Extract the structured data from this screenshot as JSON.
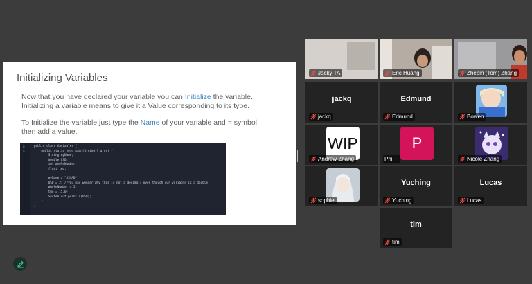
{
  "slide": {
    "title": "Initializing Variables",
    "para1_a": "Now that you have declared your variable you can ",
    "para1_hl": "Initialize",
    "para1_b": " the variable.",
    "para1_line2": "Initializing a variable means to give it a Value corresponding to its type.",
    "para2_a": "To Initialize the variable just type the ",
    "para2_hl1": "Name",
    "para2_b": " of your variable and ",
    "para2_hl2": "=",
    "para2_c": " symbol",
    "para2_line2": "then add a value."
  },
  "code_lines": [
    "public class Variables {",
    "    public static void main(String[] args) {",
    "        String myName;",
    "        double USD;",
    "        int wholeNumber;",
    "        float two;",
    "",
    "        myName = \"ASSAD\";",
    "        USD = 2; //you may wonder why this is not a decimal? even though our variable is a double",
    "        wholeNumber = 5;",
    "        two = 15.0F;",
    "        System.out.println(USD);",
    "    }",
    "}"
  ],
  "participants": [
    {
      "label": "Jacky TA",
      "big": "",
      "muted": true
    },
    {
      "label": "Eric Huang",
      "big": "",
      "muted": true
    },
    {
      "label": "Zhebin (Tom) Zhang",
      "big": "",
      "muted": true,
      "speaking": true
    },
    {
      "label": "jackq",
      "big": "jackq",
      "muted": true
    },
    {
      "label": "Edmund",
      "big": "Edmund",
      "muted": true
    },
    {
      "label": "Bowen",
      "big": "",
      "muted": true
    },
    {
      "label": "Andrew Zhang",
      "big": "",
      "muted": true,
      "avatar_text": "WIP"
    },
    {
      "label": "Phil F",
      "big": "",
      "muted": false,
      "avatar_text": "P"
    },
    {
      "label": "Nicole Zhang",
      "big": "",
      "muted": true
    },
    {
      "label": "sophie",
      "big": "",
      "muted": true
    },
    {
      "label": "Yuching",
      "big": "Yuching",
      "muted": true
    },
    {
      "label": "Lucas",
      "big": "Lucas",
      "muted": true
    },
    {
      "label": "tim",
      "big": "tim",
      "muted": true
    }
  ],
  "colors": {
    "accent": "#3ecf8e",
    "mute": "#e74c3c",
    "phil_avatar": "#d4145a",
    "link": "#3b82c4"
  },
  "icons": {
    "mute": "mic-off-icon",
    "annotate": "pencil-icon"
  }
}
